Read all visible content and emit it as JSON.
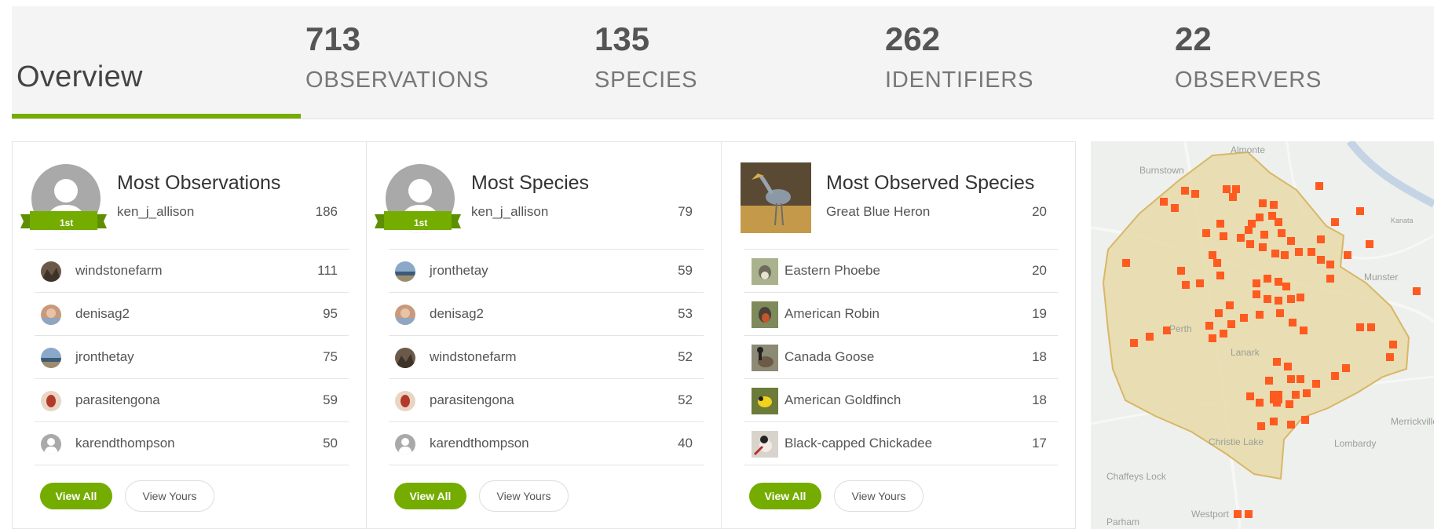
{
  "tabs": {
    "overview": "Overview",
    "stats": [
      {
        "value": "713",
        "label": "OBSERVATIONS"
      },
      {
        "value": "135",
        "label": "SPECIES"
      },
      {
        "value": "262",
        "label": "IDENTIFIERS"
      },
      {
        "value": "22",
        "label": "OBSERVERS"
      }
    ]
  },
  "panels": {
    "most_observations": {
      "title": "Most Observations",
      "badge": "1st",
      "leader": {
        "name": "ken_j_allison",
        "count": "186"
      },
      "rows": [
        {
          "name": "windstonefarm",
          "count": "111"
        },
        {
          "name": "denisag2",
          "count": "95"
        },
        {
          "name": "jronthetay",
          "count": "75"
        },
        {
          "name": "parasitengona",
          "count": "59"
        },
        {
          "name": "karendthompson",
          "count": "50"
        }
      ],
      "view_all": "View All",
      "view_yours": "View Yours"
    },
    "most_species": {
      "title": "Most Species",
      "badge": "1st",
      "leader": {
        "name": "ken_j_allison",
        "count": "79"
      },
      "rows": [
        {
          "name": "jronthetay",
          "count": "59"
        },
        {
          "name": "denisag2",
          "count": "53"
        },
        {
          "name": "windstonefarm",
          "count": "52"
        },
        {
          "name": "parasitengona",
          "count": "52"
        },
        {
          "name": "karendthompson",
          "count": "40"
        }
      ],
      "view_all": "View All",
      "view_yours": "View Yours"
    },
    "most_observed_species": {
      "title": "Most Observed Species",
      "leader": {
        "name": "Great Blue Heron",
        "count": "20"
      },
      "rows": [
        {
          "name": "Eastern Phoebe",
          "count": "20"
        },
        {
          "name": "American Robin",
          "count": "19"
        },
        {
          "name": "Canada Goose",
          "count": "18"
        },
        {
          "name": "American Goldfinch",
          "count": "18"
        },
        {
          "name": "Black-capped Chickadee",
          "count": "17"
        }
      ],
      "view_all": "View All",
      "view_yours": "View Yours"
    }
  },
  "map": {
    "labels": [
      "Almonte",
      "Burnstown",
      "Kanata",
      "Munster",
      "Lanark",
      "Merrickville",
      "Lombardy",
      "Chaffeys Lock",
      "Westport",
      "Perth",
      "Parham",
      "Christie Lake"
    ],
    "colors": {
      "region_fill": "#e8d9a8",
      "region_border": "#d8b766",
      "cell": "#ff5a1f"
    }
  },
  "colors": {
    "accent": "#74ac00"
  }
}
